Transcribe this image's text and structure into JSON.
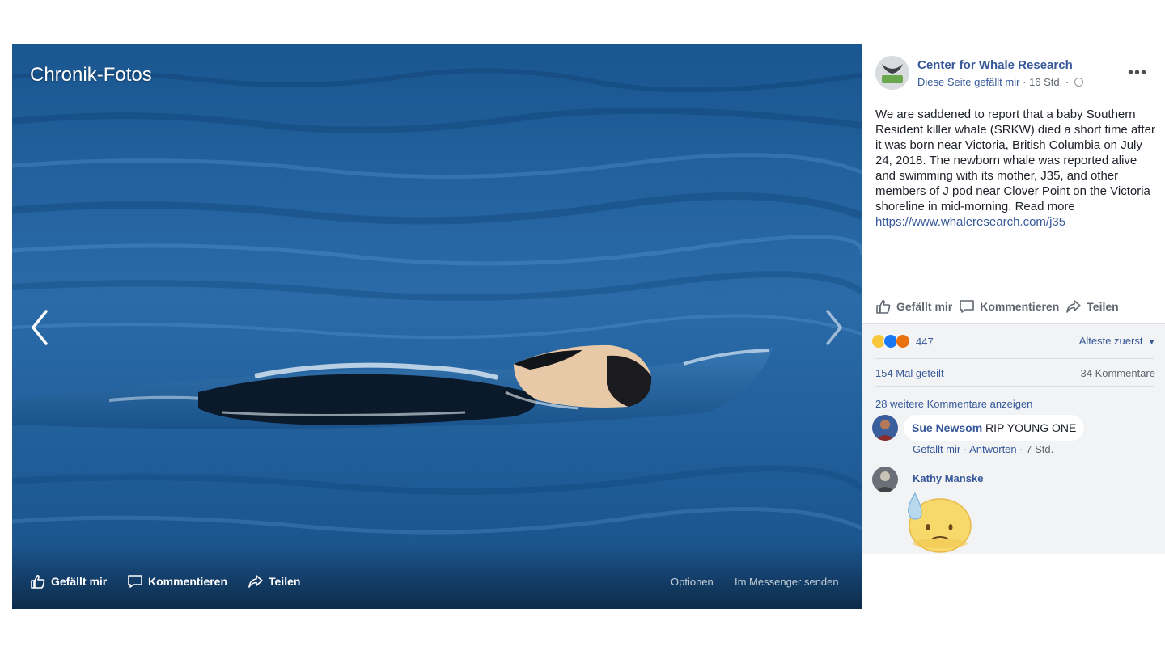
{
  "viewer": {
    "album_title": "Chronik-Fotos",
    "actions": {
      "like": "Gefällt mir",
      "comment": "Kommentieren",
      "share": "Teilen",
      "options": "Optionen",
      "messenger": "Im Messenger senden"
    }
  },
  "post": {
    "page_name": "Center for Whale Research",
    "like_page": "Diese Seite gefällt mir",
    "separator": "·",
    "time": "16 Std.",
    "more_icon": "•••",
    "text": "We are saddened to report that a baby Southern Resident killer whale (SRKW) died a short time after it was born near Victoria, British Columbia on July 24, 2018. The newborn whale was reported alive and swimming with its mother, J35, and other members of J pod near Clover Point on the Victoria shoreline in mid-morning. Read more ",
    "link": "https://www.whaleresearch.com/j35",
    "actions": {
      "like": "Gefällt mir",
      "comment": "Kommentieren",
      "share": "Teilen"
    }
  },
  "reactions": {
    "icons": [
      "sad-reaction",
      "like-reaction",
      "angry-reaction"
    ],
    "count": "447",
    "sort": "Älteste zuerst"
  },
  "stats": {
    "shares": "154 Mal geteilt",
    "comments": "34 Kommentare"
  },
  "comments": {
    "more": "28 weitere Kommentare anzeigen",
    "items": [
      {
        "author": "Sue Newsom",
        "text": "RIP YOUNG ONE",
        "like": "Gefällt mir",
        "reply": "Antworten",
        "time": "7 Std."
      },
      {
        "author": "Kathy Manske",
        "sticker": "crying-face-sticker"
      }
    ]
  },
  "colors": {
    "link": "#365899",
    "panel_gray": "#f2f3f5",
    "ocean": "#1d5d93"
  }
}
